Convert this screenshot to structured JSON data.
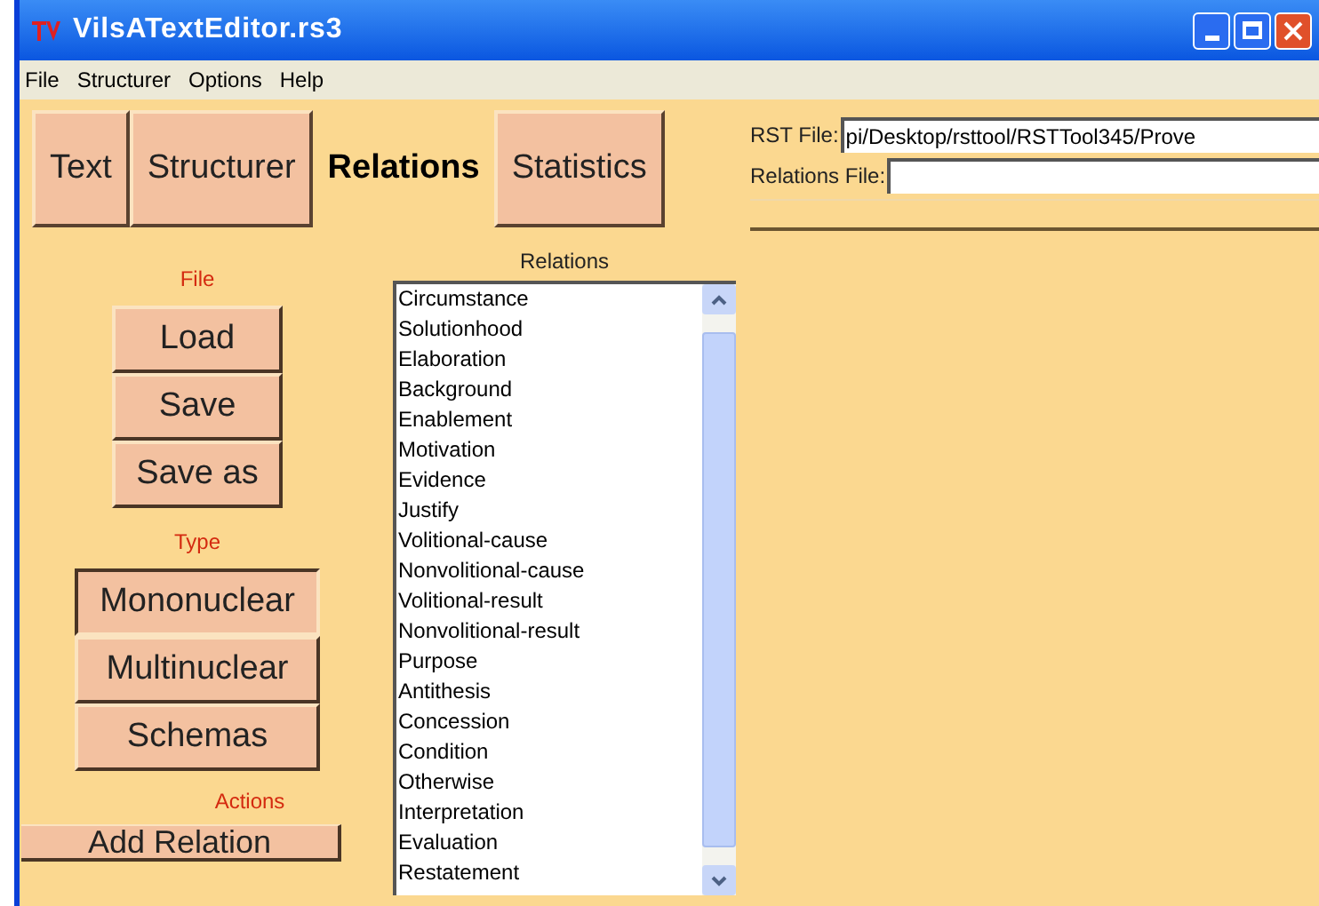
{
  "window": {
    "title": "VilsATextEditor.rs3"
  },
  "menu": [
    "File",
    "Structurer",
    "Options",
    "Help"
  ],
  "tabs": [
    {
      "label": "Text",
      "selected": false
    },
    {
      "label": "Structurer",
      "selected": false
    },
    {
      "label": "Relations",
      "selected": true
    },
    {
      "label": "Statistics",
      "selected": false
    }
  ],
  "file_section": {
    "heading": "File",
    "buttons": [
      "Load",
      "Save",
      "Save as"
    ]
  },
  "type_section": {
    "heading": "Type",
    "options": [
      {
        "label": "Mononuclear",
        "selected": true
      },
      {
        "label": "Multinuclear",
        "selected": false
      },
      {
        "label": "Schemas",
        "selected": false
      }
    ]
  },
  "actions_section": {
    "heading": "Actions",
    "buttons": [
      "Add Relation"
    ]
  },
  "relations_list": {
    "heading": "Relations",
    "items": [
      "Circumstance",
      "Solutionhood",
      "Elaboration",
      "Background",
      "Enablement",
      "Motivation",
      "Evidence",
      "Justify",
      "Volitional-cause",
      "Nonvolitional-cause",
      "Volitional-result",
      "Nonvolitional-result",
      "Purpose",
      "Antithesis",
      "Concession",
      "Condition",
      "Otherwise",
      "Interpretation",
      "Evaluation",
      "Restatement"
    ]
  },
  "files": [
    {
      "label": "RST File:",
      "value": "pi/Desktop/rsttool/RSTTool345/Prove"
    },
    {
      "label": "Relations File:"
    }
  ]
}
